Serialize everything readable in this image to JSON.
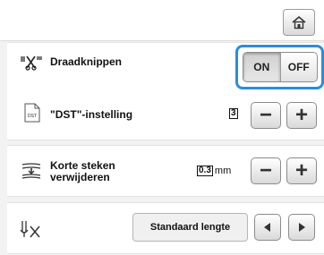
{
  "settings": {
    "thread_cut": {
      "label": "Draadknippen",
      "on_label": "ON",
      "off_label": "OFF",
      "selected": "ON",
      "highlight_color": "#2a8ed8"
    },
    "dst": {
      "label": "\"DST\"-instelling",
      "icon_text": "DST",
      "value": "3",
      "minus": "−",
      "plus": "+"
    },
    "short_stitches": {
      "label_line1": "Korte steken",
      "label_line2": "verwijderen",
      "value": "0.3",
      "unit": "mm",
      "minus": "−",
      "plus": "+"
    },
    "length": {
      "value": "Standaard lengte"
    }
  },
  "icons": {
    "home": "home-icon",
    "thread_cut": "thread-cutting-icon",
    "dst": "dst-file-icon",
    "short_stitches": "short-stitches-icon",
    "length": "jump-stitch-length-icon"
  }
}
